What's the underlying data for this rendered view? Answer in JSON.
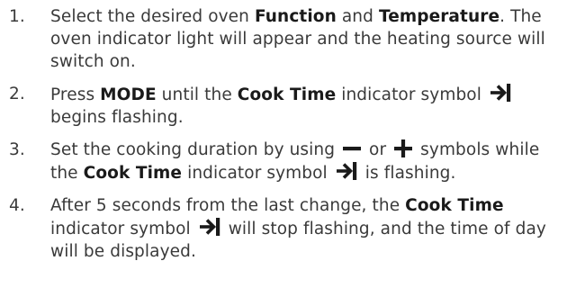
{
  "steps": [
    {
      "number": "1.",
      "segments": [
        {
          "t": "Select the desired oven "
        },
        {
          "b": "Function"
        },
        {
          "t": " and "
        },
        {
          "b": "Temperature"
        },
        {
          "t": ". The oven indicator light will appear and the heating source will switch on."
        }
      ]
    },
    {
      "number": "2.",
      "segments": [
        {
          "t": "Press "
        },
        {
          "b": "MODE"
        },
        {
          "t": " until the "
        },
        {
          "b": "Cook Time"
        },
        {
          "t": " indicator symbol "
        },
        {
          "icon": "cook-time-icon"
        },
        {
          "t": " begins flashing."
        }
      ]
    },
    {
      "number": "3.",
      "segments": [
        {
          "t": "Set the cooking duration by using "
        },
        {
          "icon": "minus-icon"
        },
        {
          "t": " or "
        },
        {
          "icon": "plus-icon"
        },
        {
          "t": " symbols while the "
        },
        {
          "b": "Cook Time"
        },
        {
          "t": " indicator symbol "
        },
        {
          "icon": "cook-time-icon"
        },
        {
          "t": " is flashing."
        }
      ]
    },
    {
      "number": "4.",
      "segments": [
        {
          "t": "After 5 seconds from the last change, the "
        },
        {
          "b": "Cook Time"
        },
        {
          "t": " indicator symbol "
        },
        {
          "icon": "cook-time-icon"
        },
        {
          "t": " will stop flashing, and the time of day will be displayed."
        }
      ]
    }
  ]
}
